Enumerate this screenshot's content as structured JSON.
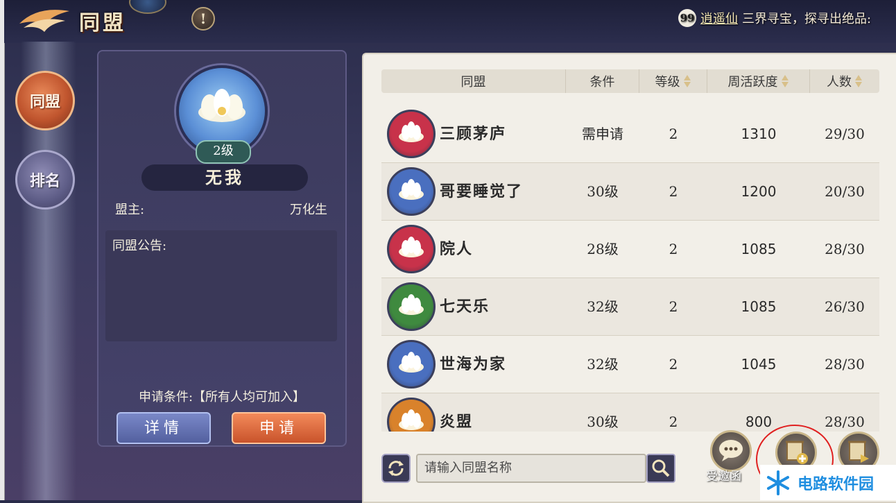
{
  "header": {
    "title": "同盟",
    "help_glyph": "!",
    "ticker_badge": "99",
    "ticker_name": "逍遥仙",
    "ticker_text": "三界寻宝，探寻出绝品:"
  },
  "nav": {
    "items": [
      {
        "label": "同盟",
        "active": true
      },
      {
        "label": "排名",
        "active": false
      }
    ]
  },
  "alliance": {
    "level": "2级",
    "name": "无我",
    "leader_label": "盟主:",
    "leader_name": "万化生",
    "notice_label": "同盟公告:",
    "condition_text": "申请条件:【所有人均可加入】",
    "detail_button": "详情",
    "apply_button": "申请"
  },
  "table": {
    "columns": [
      {
        "label": "同盟",
        "sortable": false
      },
      {
        "label": "条件",
        "sortable": false
      },
      {
        "label": "等级",
        "sortable": true
      },
      {
        "label": "周活跃度",
        "sortable": true
      },
      {
        "label": "人数",
        "sortable": true
      }
    ],
    "rows": [
      {
        "name": "三顾茅庐",
        "condition": "需申请",
        "level": "2",
        "activity": "1310",
        "members": "29/30",
        "emblem_color": "#c8324a"
      },
      {
        "name": "哥要睡觉了",
        "condition": "30级",
        "level": "2",
        "activity": "1200",
        "members": "20/30",
        "emblem_color": "#4a6fbf"
      },
      {
        "name": "院人",
        "condition": "28级",
        "level": "2",
        "activity": "1085",
        "members": "28/30",
        "emblem_color": "#c8324a"
      },
      {
        "name": "七天乐",
        "condition": "32级",
        "level": "2",
        "activity": "1085",
        "members": "26/30",
        "emblem_color": "#3f8a3f"
      },
      {
        "name": "世海为家",
        "condition": "32级",
        "level": "2",
        "activity": "1045",
        "members": "28/30",
        "emblem_color": "#4a6fbf"
      },
      {
        "name": "炎盟",
        "condition": "30级",
        "level": "2",
        "activity": "800",
        "members": "28/30",
        "emblem_color": "#d9822b"
      }
    ]
  },
  "search": {
    "placeholder": "请输入同盟名称"
  },
  "actions": {
    "invite_label": "受邀函"
  },
  "watermark": {
    "text": "电路软件园"
  },
  "colors": {
    "accent_orange": "#c9532b",
    "accent_blue": "#53609f",
    "panel_bg": "#f2efe8"
  }
}
